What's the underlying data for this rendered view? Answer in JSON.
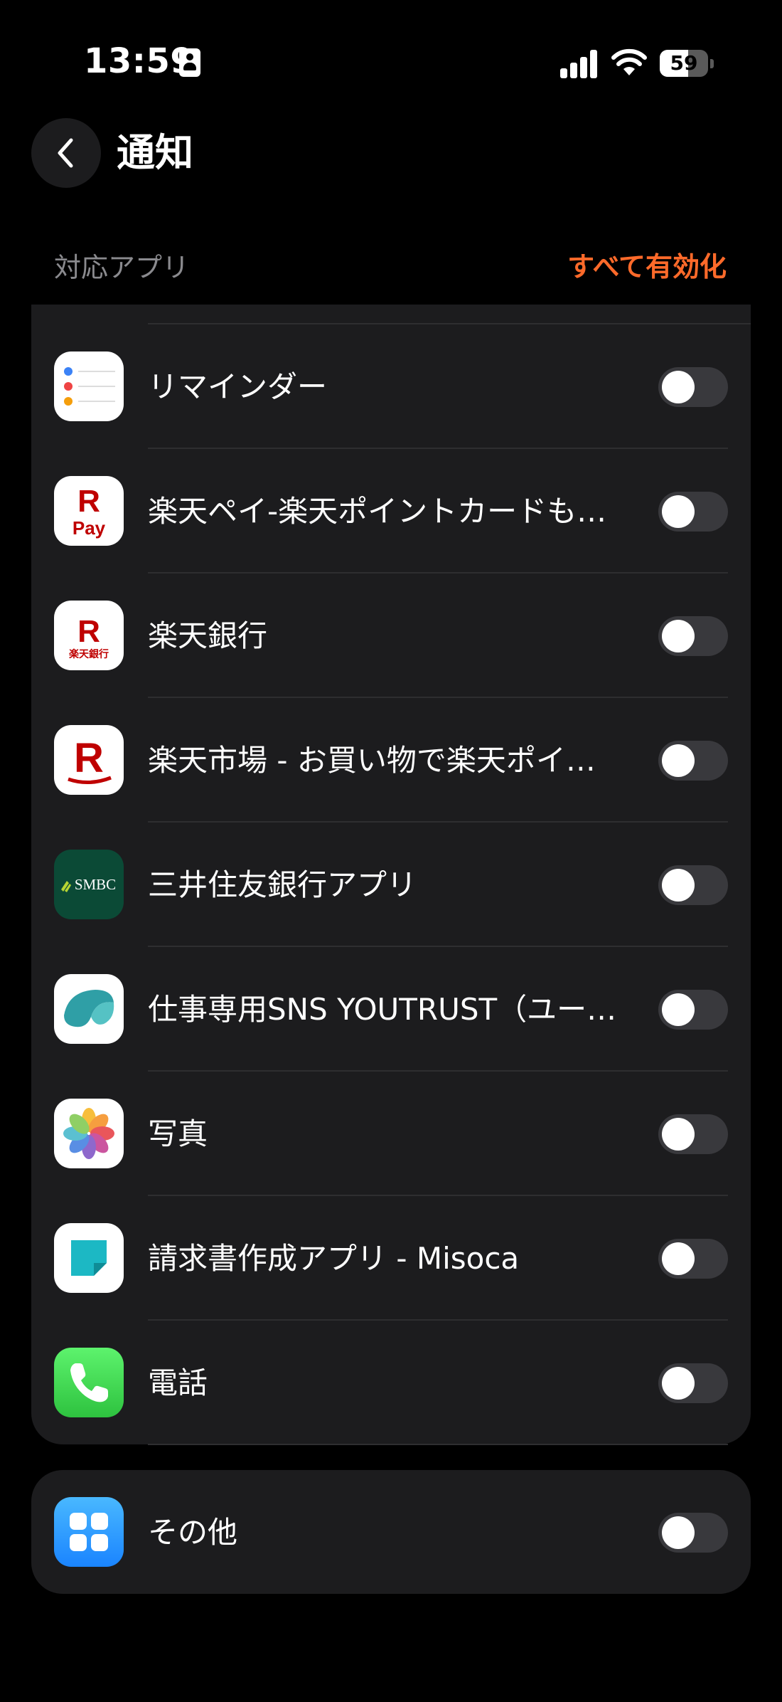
{
  "status_bar": {
    "time": "13:59",
    "battery_level": "59",
    "battery_fraction": 0.59
  },
  "header": {
    "title": "通知"
  },
  "section": {
    "label": "対応アプリ",
    "enable_all": "すべて有効化"
  },
  "apps": [
    {
      "name": "リマインダー",
      "icon": "reminders-icon",
      "enabled": false
    },
    {
      "name": "楽天ペイ-楽天ポイントカードも…",
      "icon": "rakuten-pay-icon",
      "enabled": false,
      "icon_text": [
        "R",
        "Pay"
      ]
    },
    {
      "name": "楽天銀行",
      "icon": "rakuten-bank-icon",
      "enabled": false,
      "icon_text": [
        "R",
        "楽天銀行"
      ]
    },
    {
      "name": "楽天市場 - お買い物で楽天ポイ…",
      "icon": "rakuten-ichiba-icon",
      "enabled": false,
      "icon_text": [
        "R"
      ]
    },
    {
      "name": "三井住友銀行アプリ",
      "icon": "smbc-icon",
      "enabled": false,
      "icon_text": [
        "SMBC"
      ]
    },
    {
      "name": "仕事専用SNS YOUTRUST（ユー…",
      "icon": "youtrust-icon",
      "enabled": false
    },
    {
      "name": "写真",
      "icon": "photos-icon",
      "enabled": false
    },
    {
      "name": "請求書作成アプリ - Misoca",
      "icon": "misoca-icon",
      "enabled": false
    },
    {
      "name": "電話",
      "icon": "phone-icon",
      "enabled": false
    }
  ],
  "other": {
    "name": "その他",
    "icon": "grid-apps-icon",
    "enabled": false
  },
  "colors": {
    "accent": "#ff6a2a",
    "card": "#1c1c1e",
    "toggle_off": "#39393d",
    "secondary_text": "#8a8a8e"
  }
}
